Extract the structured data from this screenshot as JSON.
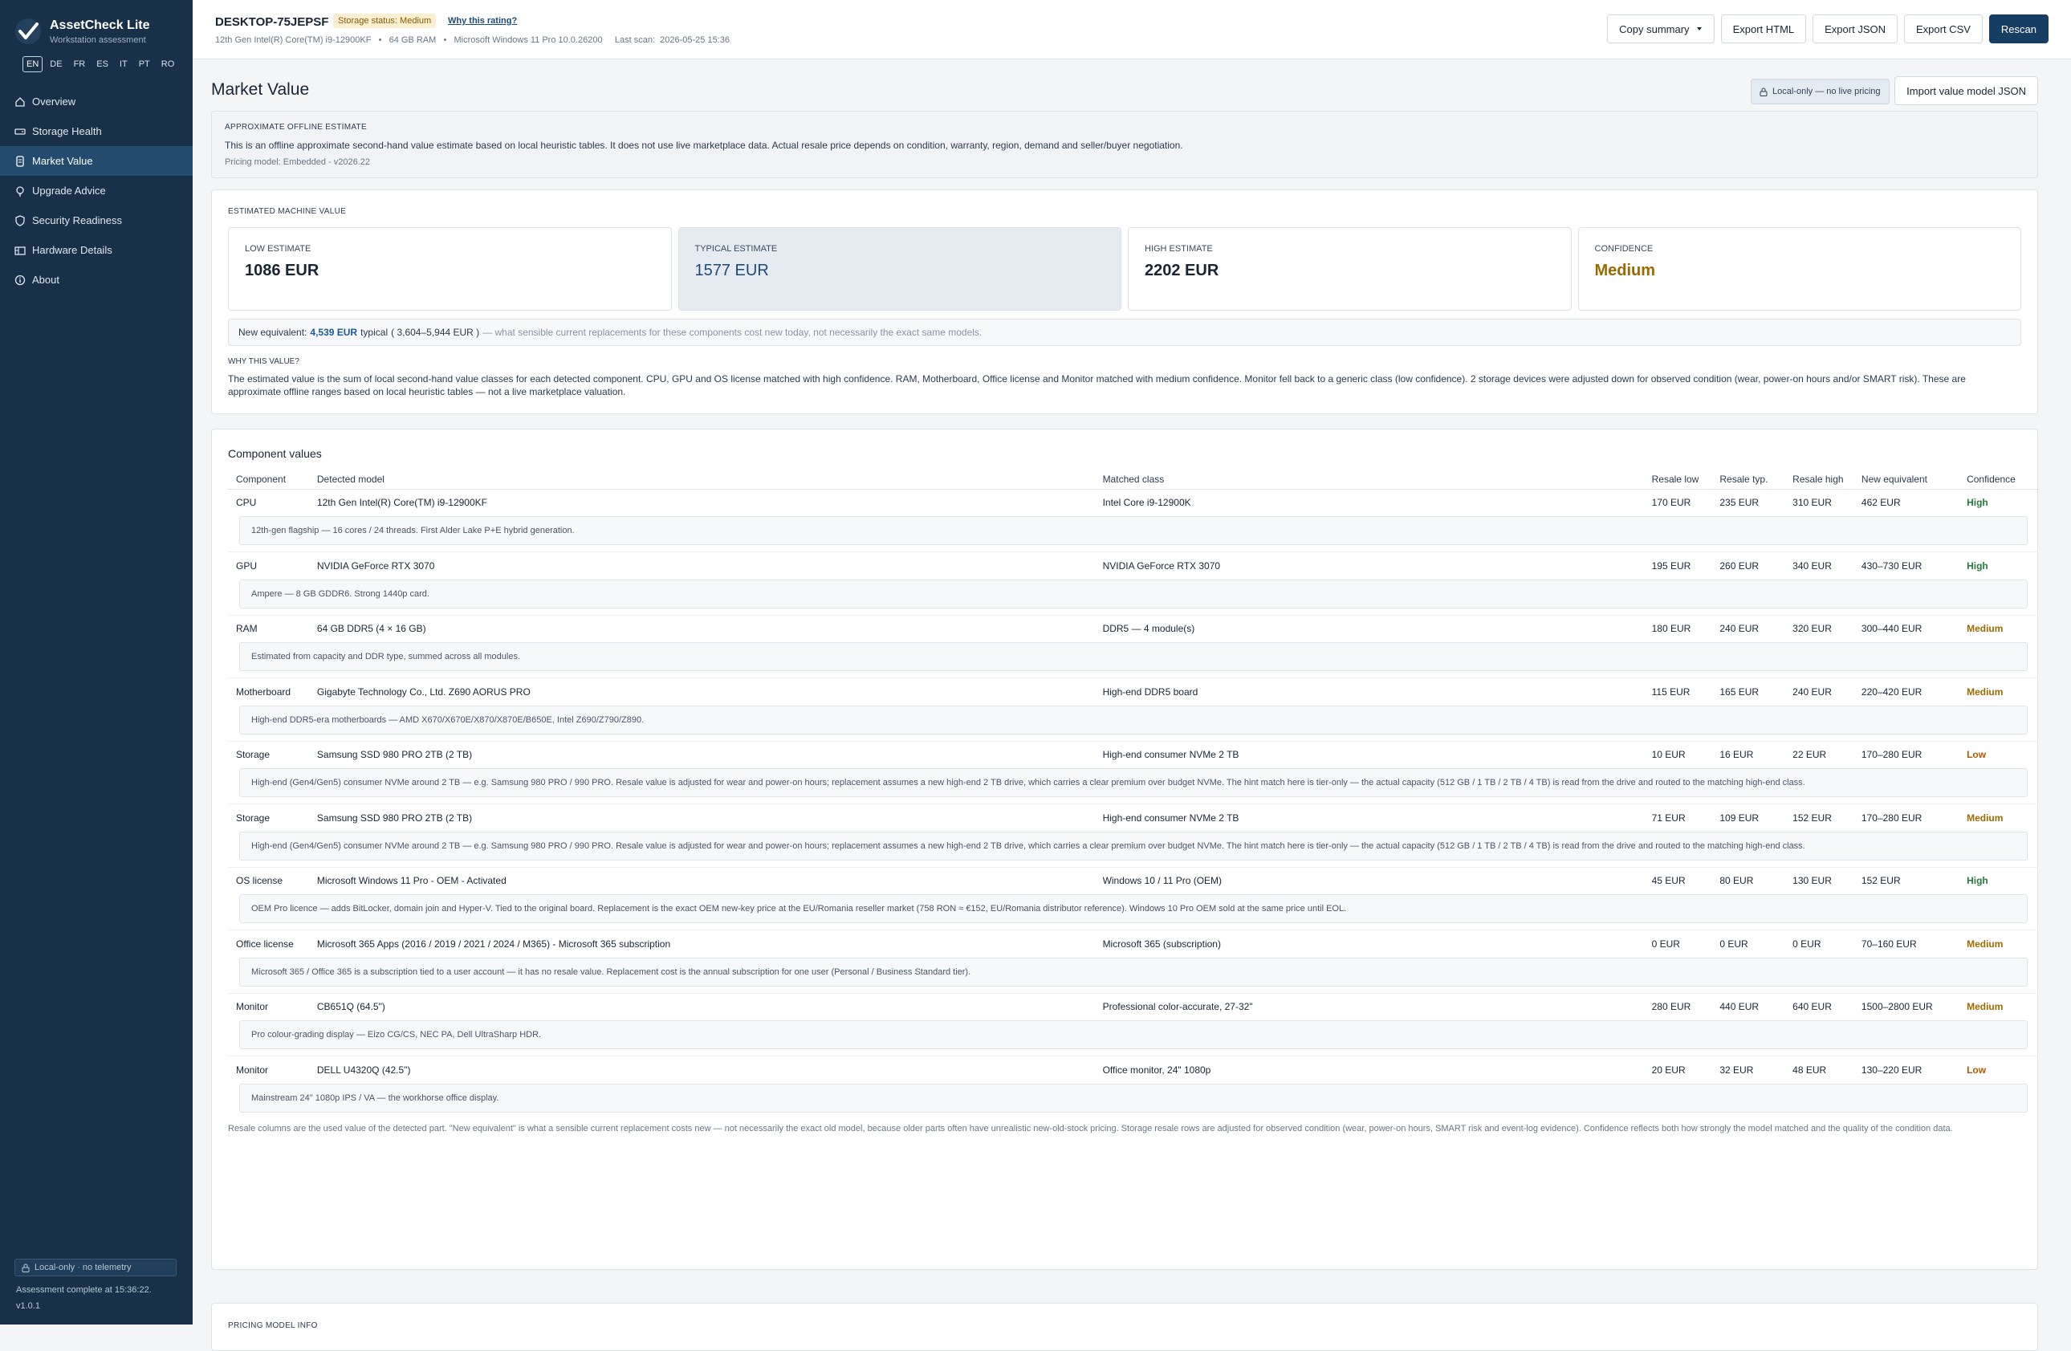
{
  "app": {
    "name": "AssetCheck Lite",
    "subtitle": "Workstation assessment",
    "languages": [
      "EN",
      "DE",
      "FR",
      "ES",
      "IT",
      "PT",
      "RO"
    ],
    "active_language": "EN",
    "version": "v1.0.1",
    "local_badge": "Local-only · no telemetry",
    "status": "Assessment complete at 15:36:22."
  },
  "nav": [
    {
      "label": "Overview",
      "icon": "home-icon"
    },
    {
      "label": "Storage Health",
      "icon": "drive-icon"
    },
    {
      "label": "Market Value",
      "icon": "price-tag-icon",
      "active": true
    },
    {
      "label": "Upgrade Advice",
      "icon": "lightbulb-icon"
    },
    {
      "label": "Security Readiness",
      "icon": "shield-icon"
    },
    {
      "label": "Hardware Details",
      "icon": "hardware-icon"
    },
    {
      "label": "About",
      "icon": "info-icon"
    }
  ],
  "header": {
    "hostname": "DESKTOP-75JEPSF",
    "storage_status": "Storage status: Medium",
    "why_rating": "Why this rating?",
    "cpu": "12th Gen Intel(R) Core(TM) i9-12900KF",
    "sep": "•",
    "ram": "64 GB RAM",
    "os": "Microsoft Windows 11 Pro 10.0.26200",
    "last_scan_label": "Last scan:",
    "last_scan": "2026-05-25 15:36",
    "buttons": {
      "copy": "Copy summary",
      "html": "Export HTML",
      "json": "Export JSON",
      "csv": "Export CSV",
      "rescan": "Rescan"
    }
  },
  "page": {
    "title": "Market Value",
    "local_pill": "Local-only — no live pricing",
    "import_button": "Import value model JSON"
  },
  "info": {
    "heading": "APPROXIMATE OFFLINE ESTIMATE",
    "text": "This is an offline approximate second-hand value estimate based on local heuristic tables. It does not use live marketplace data. Actual resale price depends on condition, warranty, region, demand and seller/buyer negotiation.",
    "model": "Pricing model: Embedded - v2026.22"
  },
  "estimate": {
    "heading": "ESTIMATED MACHINE VALUE",
    "low_label": "LOW ESTIMATE",
    "low": "1086 EUR",
    "typical_label": "TYPICAL ESTIMATE",
    "typical": "1577 EUR",
    "high_label": "HIGH ESTIMATE",
    "high": "2202 EUR",
    "confidence_label": "CONFIDENCE",
    "confidence": "Medium",
    "new_eq_label": "New equivalent:",
    "new_eq_value": "4,539 EUR",
    "new_eq_typical": "typical",
    "new_eq_range": "( 3,604–5,944 EUR )",
    "new_eq_note": "— what sensible current replacements for these components cost new today, not necessarily the exact same models.",
    "why_heading": "WHY THIS VALUE?",
    "why_text": "The estimated value is the sum of local second-hand value classes for each detected component. CPU, GPU and OS license matched with high confidence. RAM, Motherboard, Office license and Monitor matched with medium confidence. Monitor fell back to a generic class (low confidence). 2 storage devices were adjusted down for observed condition (wear, power-on hours and/or SMART risk). These are approximate offline ranges based on local heuristic tables — not a live marketplace valuation."
  },
  "components": {
    "title": "Component values",
    "columns": [
      "Component",
      "Detected model",
      "Matched class",
      "Resale low",
      "Resale typ.",
      "Resale high",
      "New equivalent",
      "Confidence"
    ],
    "rows": [
      {
        "component": "CPU",
        "model": "12th Gen Intel(R) Core(TM) i9-12900KF",
        "class": "Intel Core i9-12900K",
        "low": "170 EUR",
        "typ": "235 EUR",
        "high": "310 EUR",
        "new": "462 EUR",
        "conf": "High",
        "note": "12th-gen flagship — 16 cores / 24 threads. First Alder Lake P+E hybrid generation."
      },
      {
        "component": "GPU",
        "model": "NVIDIA GeForce RTX 3070",
        "class": "NVIDIA GeForce RTX 3070",
        "low": "195 EUR",
        "typ": "260 EUR",
        "high": "340 EUR",
        "new": "430–730 EUR",
        "conf": "High",
        "note": "Ampere — 8 GB GDDR6. Strong 1440p card."
      },
      {
        "component": "RAM",
        "model": "64 GB DDR5  (4 × 16 GB)",
        "class": "DDR5 — 4 module(s)",
        "low": "180 EUR",
        "typ": "240 EUR",
        "high": "320 EUR",
        "new": "300–440 EUR",
        "conf": "Medium",
        "note": "Estimated from capacity and DDR type, summed across all modules."
      },
      {
        "component": "Motherboard",
        "model": "Gigabyte Technology Co., Ltd. Z690 AORUS PRO",
        "class": "High-end DDR5 board",
        "low": "115 EUR",
        "typ": "165 EUR",
        "high": "240 EUR",
        "new": "220–420 EUR",
        "conf": "Medium",
        "note": "High-end DDR5-era motherboards — AMD X670/X670E/X870/X870E/B650E, Intel Z690/Z790/Z890."
      },
      {
        "component": "Storage",
        "model": "Samsung SSD 980 PRO 2TB (2 TB)",
        "class": "High-end consumer NVMe 2 TB",
        "low": "10 EUR",
        "typ": "16 EUR",
        "high": "22 EUR",
        "new": "170–280 EUR",
        "conf": "Low",
        "note": "High-end (Gen4/Gen5) consumer NVMe around 2 TB — e.g. Samsung 980 PRO / 990 PRO. Resale value is adjusted for wear and power-on hours; replacement assumes a new high-end 2 TB drive, which carries a clear premium over budget NVMe. The hint match here is tier-only — the actual capacity (512 GB / 1 TB / 2 TB / 4 TB) is read from the drive and routed to the matching high-end class."
      },
      {
        "component": "Storage",
        "model": "Samsung SSD 980 PRO 2TB (2 TB)",
        "class": "High-end consumer NVMe 2 TB",
        "low": "71 EUR",
        "typ": "109 EUR",
        "high": "152 EUR",
        "new": "170–280 EUR",
        "conf": "Medium",
        "note": "High-end (Gen4/Gen5) consumer NVMe around 2 TB — e.g. Samsung 980 PRO / 990 PRO. Resale value is adjusted for wear and power-on hours; replacement assumes a new high-end 2 TB drive, which carries a clear premium over budget NVMe. The hint match here is tier-only — the actual capacity (512 GB / 1 TB / 2 TB / 4 TB) is read from the drive and routed to the matching high-end class."
      },
      {
        "component": "OS license",
        "model": "Microsoft Windows 11 Pro - OEM - Activated",
        "class": "Windows 10 / 11 Pro (OEM)",
        "low": "45 EUR",
        "typ": "80 EUR",
        "high": "130 EUR",
        "new": "152 EUR",
        "conf": "High",
        "note": "OEM Pro licence — adds BitLocker, domain join and Hyper-V. Tied to the original board. Replacement is the exact OEM new-key price at the EU/Romania reseller market (758 RON ≈ €152, EU/Romania distributor reference). Windows 10 Pro OEM sold at the same price until EOL."
      },
      {
        "component": "Office license",
        "model": "Microsoft 365 Apps (2016 / 2019 / 2021 / 2024 / M365) - Microsoft 365 subscription",
        "class": "Microsoft 365 (subscription)",
        "low": "0 EUR",
        "typ": "0 EUR",
        "high": "0 EUR",
        "new": "70–160 EUR",
        "conf": "Medium",
        "note": "Microsoft 365 / Office 365 is a subscription tied to a user account — it has no resale value. Replacement cost is the annual subscription for one user (Personal / Business Standard tier)."
      },
      {
        "component": "Monitor",
        "model": "CB651Q (64.5\")",
        "class": "Professional color-accurate, 27-32\"",
        "low": "280 EUR",
        "typ": "440 EUR",
        "high": "640 EUR",
        "new": "1500–2800 EUR",
        "conf": "Medium",
        "note": "Pro colour-grading display — Eizo CG/CS, NEC PA, Dell UltraSharp HDR."
      },
      {
        "component": "Monitor",
        "model": "DELL U4320Q (42.5\")",
        "class": "Office monitor, 24\" 1080p",
        "low": "20 EUR",
        "typ": "32 EUR",
        "high": "48 EUR",
        "new": "130–220 EUR",
        "conf": "Low",
        "note": "Mainstream 24\" 1080p IPS / VA — the workhorse office display."
      }
    ],
    "footnote": "Resale columns are the used value of the detected part. \"New equivalent\" is what a sensible current replacement costs new — not necessarily the exact old model, because older parts often have unrealistic new-old-stock pricing. Storage resale rows are adjusted for observed condition (wear, power-on hours, SMART risk and event-log evidence). Confidence reflects both how strongly the model matched and the quality of the condition data."
  },
  "pricing_info": {
    "heading": "PRICING MODEL INFO"
  }
}
